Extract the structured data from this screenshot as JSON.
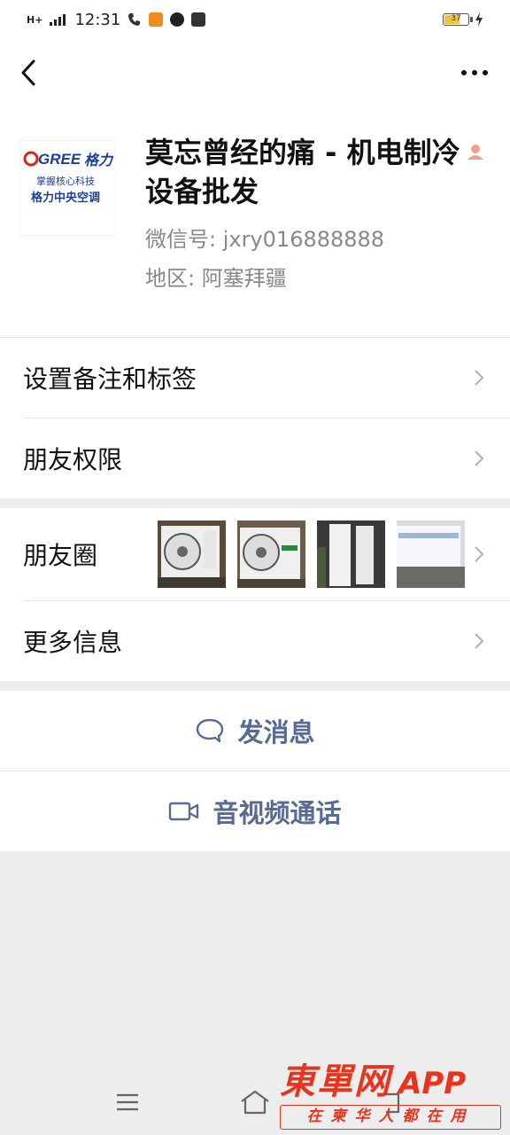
{
  "status_bar": {
    "network": "H+",
    "time": "12:31",
    "battery": "37"
  },
  "profile": {
    "name": "莫忘曾经的痛 - 机电制冷设备批发",
    "wechat_id_label": "微信号: jxry016888888",
    "region_label": "地区: 阿塞拜疆",
    "avatar_text": {
      "brand": "GREE格力",
      "line1": "掌握核心科技",
      "line2": "格力中央空调"
    }
  },
  "rows": {
    "remark_tags": "设置备注和标签",
    "friend_permissions": "朋友权限",
    "moments": "朋友圈",
    "more_info": "更多信息"
  },
  "actions": {
    "send_message": "发消息",
    "video_call": "音视频通话"
  },
  "watermark": {
    "logo": "東單网",
    "app": "APP",
    "slogan": "在柬华人都在用"
  },
  "colors": {
    "link_blue": "#576b95",
    "watermark_red": "#e8331d",
    "brand_red": "#d9261c"
  },
  "icons": [
    "back-arrow-icon",
    "more-dots-icon",
    "user-badge-icon",
    "chevron-right-icon",
    "chat-bubble-icon",
    "video-camera-icon",
    "menu-icon",
    "home-icon",
    "back-icon"
  ]
}
